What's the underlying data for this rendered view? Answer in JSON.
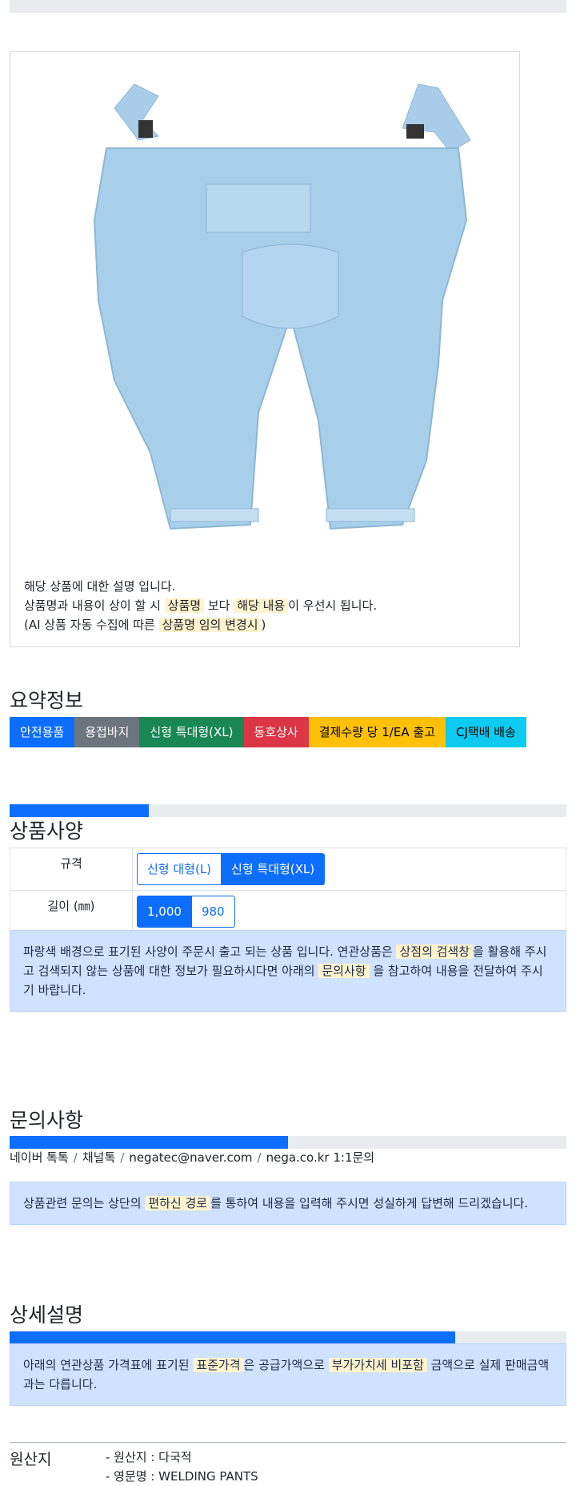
{
  "product": {
    "image_alt": "용접바지 (WELDING PANTS)",
    "desc_line1": "해당 상품에 대한 설명 입니다.",
    "desc_line2_a": "상품명과 내용이 상이 할 시",
    "desc_line2_hl1": "상품명",
    "desc_line2_b": "보다",
    "desc_line2_hl2": "해당 내용",
    "desc_line2_c": "이 우선시 됩니다.",
    "desc_line3_a": "(AI 상품 자동 수집에 따른",
    "desc_line3_hl": "상품명 임의 변경시",
    "desc_line3_b": ")"
  },
  "summary": {
    "title": "요약정보",
    "badges": [
      "안전용품",
      "용접바지",
      "신형 특대형(XL)",
      "동호상사",
      "결제수량 당 1/EA 출고",
      "CJ택배 배송"
    ]
  },
  "spec": {
    "title": "상품사양",
    "progress": 0.25,
    "rows": [
      {
        "label": "규격",
        "options": [
          "신형 대형(L)",
          "신형 특대형(XL)"
        ],
        "selected": 1
      },
      {
        "label": "길이 (㎜)",
        "options": [
          "1,000",
          "980"
        ],
        "selected": 0
      }
    ],
    "notice_a": "파랑색 배경으로 표기된 사양이 주문시 출고 되는 상품 입니다. 연관상품은",
    "notice_hl1": "상점의 검색창",
    "notice_b": "을 활용해 주시고 검색되지 않는 상품에 대한 정보가 필요하시다면 아래의",
    "notice_hl2": "문의사항",
    "notice_c": "을 참고하여 내용을 전달하여 주시기 바랍니다."
  },
  "inquiry": {
    "title": "문의사항",
    "progress": 0.5,
    "links": [
      "네이버 톡톡",
      "채널톡",
      "negatec@naver.com",
      "nega.co.kr 1:1문의"
    ],
    "notice_a": "상품관련 문의는 상단의",
    "notice_hl": "편하신 경로",
    "notice_b": "를 통하여 내용을 입력해 주시면 성실하게 답변해 드리겠습니다."
  },
  "detail": {
    "title": "상세설명",
    "progress": 0.8,
    "notice_a": "아래의 연관상품 가격표에 표기된",
    "notice_hl1": "표준가격",
    "notice_b": "은 공급가액으로",
    "notice_hl2": "부가가치세 비포함",
    "notice_c": "금액으로 실제 판매금액과는 다릅니다."
  },
  "origin": {
    "label": "원산지",
    "line1": "- 원산지 : 다국적",
    "line2": "- 영문명 : WELDING PANTS"
  },
  "colors": {
    "primary": "#0d6efd",
    "alert_bg": "#cfe2ff",
    "highlight": "#fff3cd"
  }
}
